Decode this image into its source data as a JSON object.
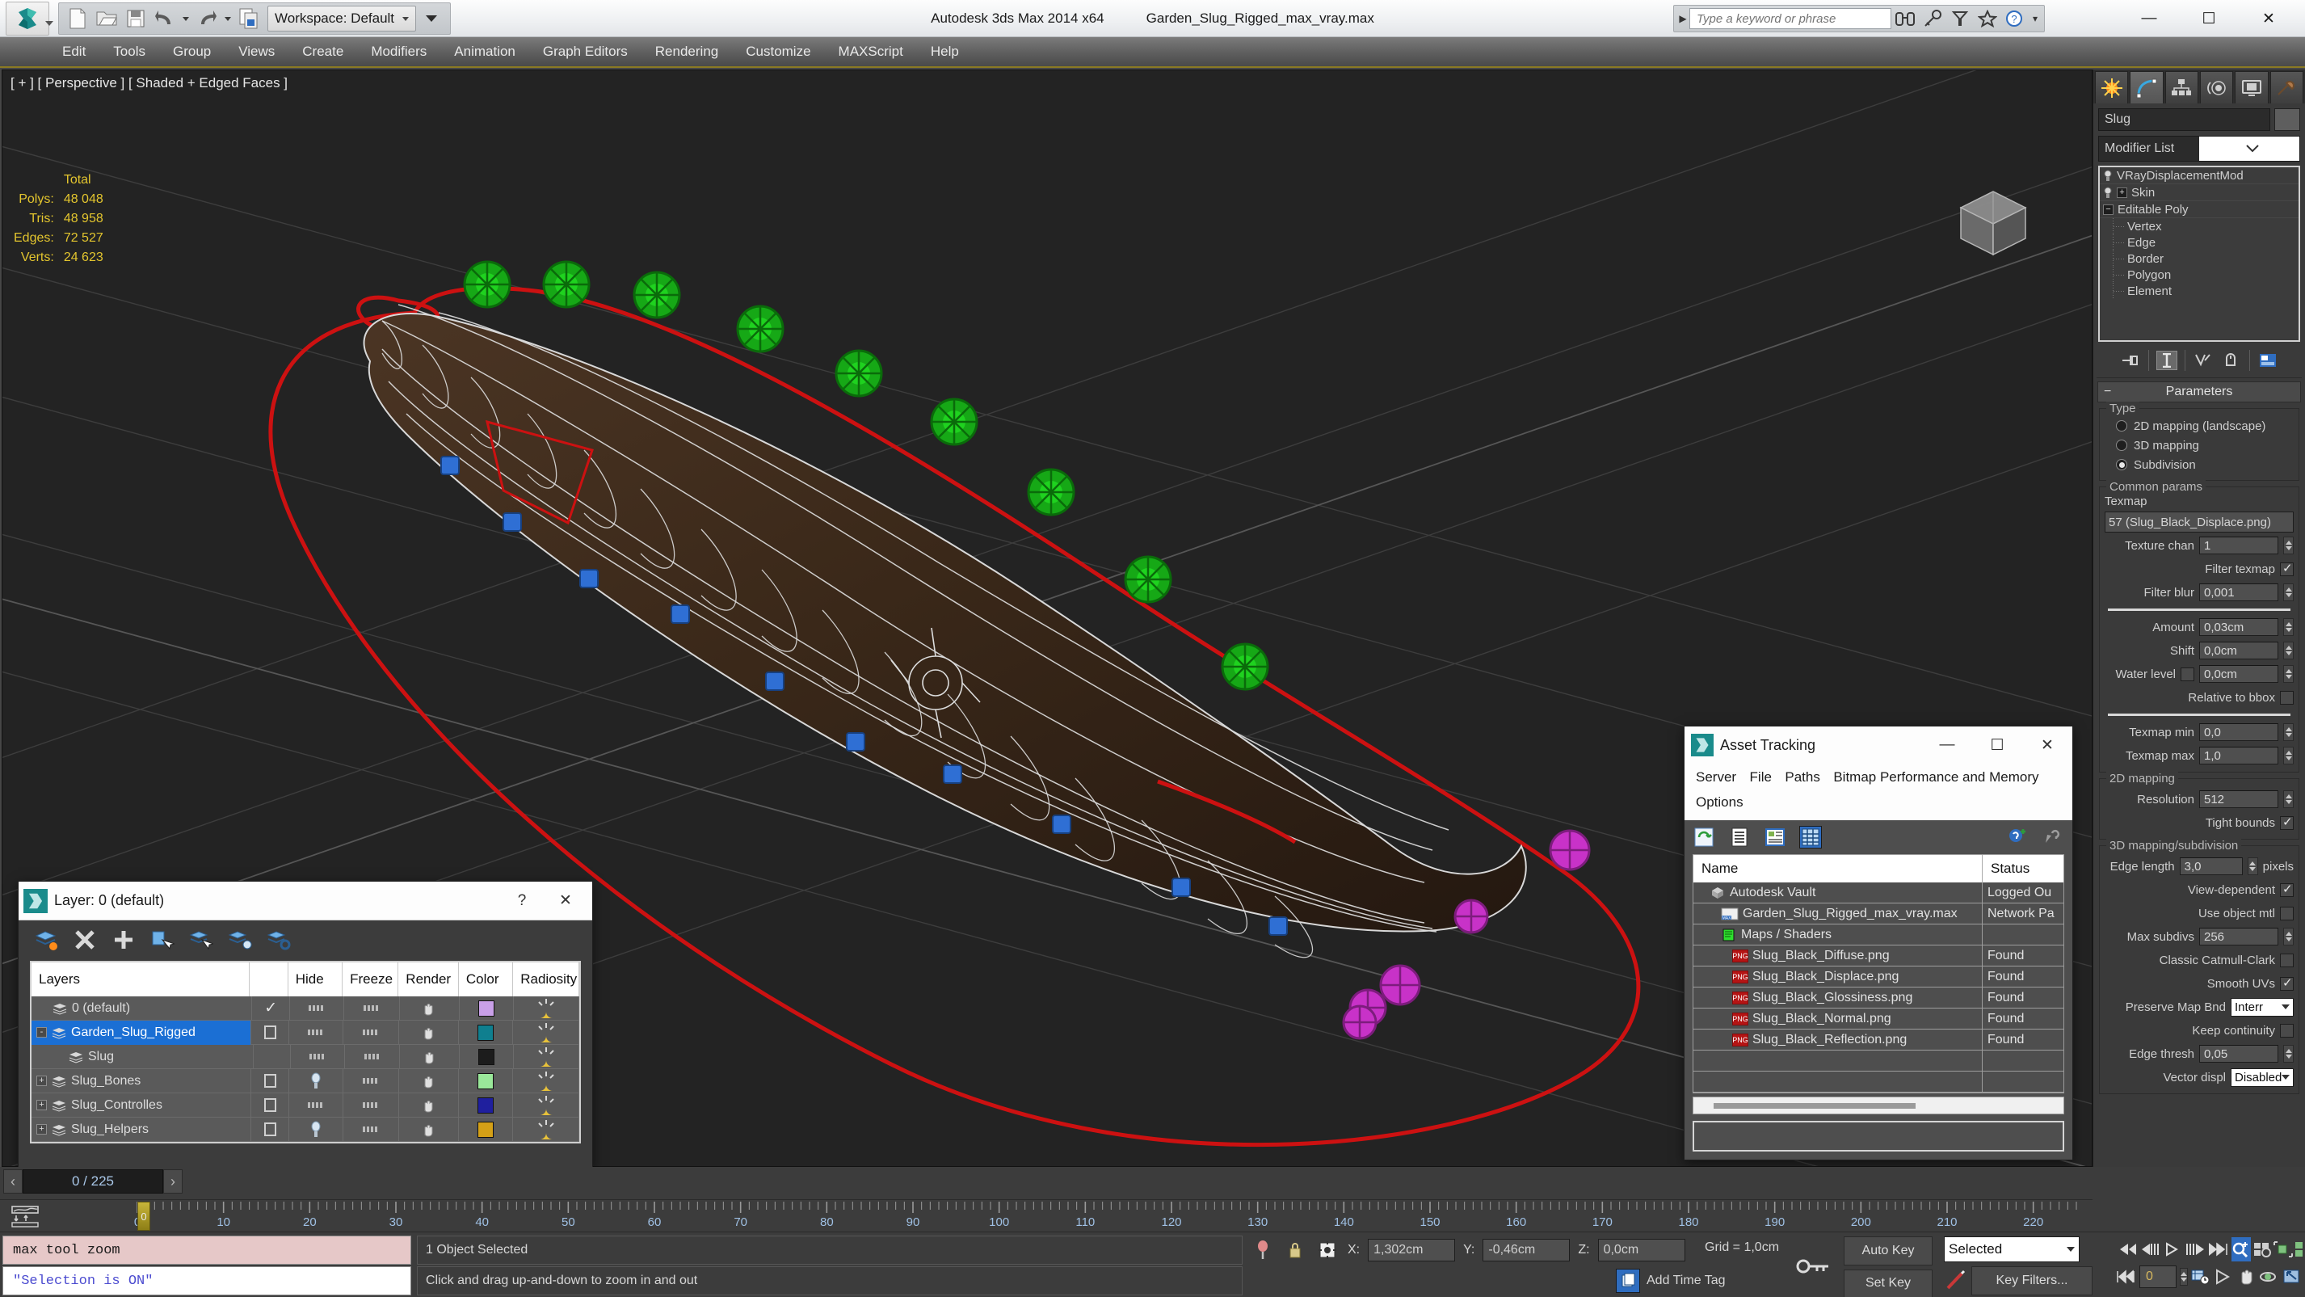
{
  "window": {
    "app_title": "Autodesk 3ds Max  2014 x64",
    "file_title": "Garden_Slug_Rigged_max_vray.max",
    "minimize": "—",
    "maximize": "☐",
    "close": "✕"
  },
  "quick_access": {
    "workspace_label": "Workspace: Default",
    "icons": [
      "new-icon",
      "open-icon",
      "save-icon",
      "undo-icon",
      "redo-icon",
      "project-icon"
    ]
  },
  "search": {
    "placeholder": "Type a keyword or phrase",
    "icons": [
      "binoculars-icon",
      "key-icon",
      "subscription-icon",
      "star-icon",
      "help-icon"
    ]
  },
  "menu": {
    "items": [
      "Edit",
      "Tools",
      "Group",
      "Views",
      "Create",
      "Modifiers",
      "Animation",
      "Graph Editors",
      "Rendering",
      "Customize",
      "MAXScript",
      "Help"
    ]
  },
  "viewport": {
    "label": "[ + ] [ Perspective ] [ Shaded + Edged Faces ]",
    "stats_header": "Total",
    "stats": [
      {
        "label": "Polys:",
        "value": "48 048"
      },
      {
        "label": "Tris:",
        "value": "48 958"
      },
      {
        "label": "Edges:",
        "value": "72 527"
      },
      {
        "label": "Verts:",
        "value": "24 623"
      }
    ]
  },
  "command_panel": {
    "tabs": [
      "create-tab",
      "modify-tab",
      "hierarchy-tab",
      "motion-tab",
      "display-tab",
      "utilities-tab"
    ],
    "active_tab_index": 1,
    "object_name": "Slug",
    "modifier_list_label": "Modifier List",
    "stack": [
      {
        "name": "VRayDisplacementMod",
        "has_expand": false,
        "indent": 1
      },
      {
        "name": "Skin",
        "has_expand": true,
        "indent": 1
      },
      {
        "name": "Editable Poly",
        "has_expand": true,
        "expanded": true,
        "indent": 0
      },
      {
        "name": "Vertex",
        "sub": true
      },
      {
        "name": "Edge",
        "sub": true
      },
      {
        "name": "Border",
        "sub": true
      },
      {
        "name": "Polygon",
        "sub": true
      },
      {
        "name": "Element",
        "sub": true
      }
    ],
    "stack_tools": [
      "pin-stack-icon",
      "show-end-result-icon",
      "make-unique-icon",
      "remove-modifier-icon",
      "configure-sets-icon"
    ],
    "rollout": {
      "title": "Parameters",
      "type_group_label": "Type",
      "type_options": [
        {
          "label": "2D mapping (landscape)",
          "selected": false
        },
        {
          "label": "3D mapping",
          "selected": false
        },
        {
          "label": "Subdivision",
          "selected": true
        }
      ],
      "common_group_label": "Common params",
      "texmap_label": "Texmap",
      "texmap_value": "57 (Slug_Black_Displace.png)",
      "fields": [
        {
          "label": "Texture chan",
          "value": "1",
          "type": "spinner"
        },
        {
          "label": "Filter texmap",
          "value": "",
          "type": "checkbox",
          "checked": true
        },
        {
          "label": "Filter blur",
          "value": "0,001",
          "type": "spinner"
        },
        {
          "label": "Amount",
          "value": "0,03cm",
          "type": "spinner"
        },
        {
          "label": "Shift",
          "value": "0,0cm",
          "type": "spinner"
        },
        {
          "label": "Water level",
          "value": "0,0cm",
          "type": "spinner-check",
          "checked": false
        },
        {
          "label": "Relative to bbox",
          "value": "",
          "type": "checkbox",
          "checked": false
        },
        {
          "label": "Texmap min",
          "value": "0,0",
          "type": "spinner"
        },
        {
          "label": "Texmap max",
          "value": "1,0",
          "type": "spinner"
        }
      ],
      "mapping2d_group_label": "2D mapping",
      "mapping2d_fields": [
        {
          "label": "Resolution",
          "value": "512",
          "type": "spinner"
        },
        {
          "label": "Tight bounds",
          "value": "",
          "type": "checkbox",
          "checked": true
        }
      ],
      "mapping3d_group_label": "3D mapping/subdivision",
      "mapping3d_fields": [
        {
          "label": "Edge length",
          "value": "3,0",
          "type": "spinner",
          "suffix": "pixels"
        },
        {
          "label": "View-dependent",
          "value": "",
          "type": "checkbox",
          "checked": true
        },
        {
          "label": "Use object mtl",
          "value": "",
          "type": "checkbox",
          "checked": false
        },
        {
          "label": "Max subdivs",
          "value": "256",
          "type": "spinner"
        },
        {
          "label": "Classic Catmull-Clark",
          "value": "",
          "type": "checkbox",
          "checked": false
        },
        {
          "label": "Smooth UVs",
          "value": "",
          "type": "checkbox",
          "checked": true
        },
        {
          "label": "Preserve Map Bnd",
          "value": "Interr",
          "type": "combo"
        },
        {
          "label": "Keep continuity",
          "value": "",
          "type": "checkbox",
          "checked": false
        },
        {
          "label": "Edge thresh",
          "value": "0,05",
          "type": "spinner"
        },
        {
          "label": "Vector displ",
          "value": "Disabled",
          "type": "combo"
        }
      ]
    }
  },
  "layer_dialog": {
    "title": "Layer: 0 (default)",
    "help_btn": "?",
    "close_btn": "✕",
    "toolbar_icons": [
      "create-new-layer-icon",
      "delete-layer-icon",
      "add-selection-icon",
      "select-objects-in-layer-icon",
      "select-highlighted-objects-icon",
      "highlight-selected-objects-icon",
      "layer-properties-icon"
    ],
    "columns": [
      "Layers",
      "",
      "Hide",
      "Freeze",
      "Render",
      "Color",
      "Radiosity"
    ],
    "rows": [
      {
        "name": "0 (default)",
        "indent": 1,
        "current": true,
        "expand": "",
        "hide": "dash",
        "freeze": "dash",
        "render": "on",
        "color": "#c9a0e8",
        "selected": false
      },
      {
        "name": "Garden_Slug_Rigged",
        "indent": 0,
        "current": false,
        "expand": "-",
        "hide": "dash",
        "freeze": "dash",
        "render": "on",
        "color": "#0f7f8f",
        "selected": true
      },
      {
        "name": "Slug",
        "indent": 2,
        "current": false,
        "expand": "",
        "hide": "dash",
        "freeze": "dash",
        "render": "on",
        "color": "#1c1c1c",
        "selected": false
      },
      {
        "name": "Slug_Bones",
        "indent": 0,
        "current": false,
        "expand": "+",
        "hide": "bulb",
        "freeze": "dash",
        "render": "on",
        "color": "#9ae89a",
        "selected": false
      },
      {
        "name": "Slug_Controlles",
        "indent": 0,
        "current": false,
        "expand": "+",
        "hide": "dash",
        "freeze": "dash",
        "render": "on",
        "color": "#1f1f9e",
        "selected": false
      },
      {
        "name": "Slug_Helpers",
        "indent": 0,
        "current": false,
        "expand": "+",
        "hide": "bulb",
        "freeze": "dash",
        "render": "on",
        "color": "#d4a017",
        "selected": false
      }
    ]
  },
  "asset_dialog": {
    "title": "Asset Tracking",
    "minimize": "—",
    "maximize": "☐",
    "close": "✕",
    "menu": [
      "Server",
      "File",
      "Paths",
      "Bitmap Performance and Memory",
      "Options"
    ],
    "toolbar_icons": [
      "refresh-icon",
      "list-view-icon",
      "detail-view-icon",
      "grid-view-icon",
      "help-new-icon",
      "help-icon"
    ],
    "columns": [
      "Name",
      "Status"
    ],
    "rows": [
      {
        "name": "Autodesk Vault",
        "status": "Logged Ou",
        "icon": "vault-icon",
        "indent": 1
      },
      {
        "name": "Garden_Slug_Rigged_max_vray.max",
        "status": "Network Pa",
        "icon": "max-file-icon",
        "indent": 2
      },
      {
        "name": "Maps / Shaders",
        "status": "",
        "icon": "maps-icon",
        "indent": 2
      },
      {
        "name": "Slug_Black_Diffuse.png",
        "status": "Found",
        "icon": "png-icon",
        "indent": 3
      },
      {
        "name": "Slug_Black_Displace.png",
        "status": "Found",
        "icon": "png-icon",
        "indent": 3
      },
      {
        "name": "Slug_Black_Glossiness.png",
        "status": "Found",
        "icon": "png-icon",
        "indent": 3
      },
      {
        "name": "Slug_Black_Normal.png",
        "status": "Found",
        "icon": "png-icon",
        "indent": 3
      },
      {
        "name": "Slug_Black_Reflection.png",
        "status": "Found",
        "icon": "png-icon",
        "indent": 3
      }
    ]
  },
  "timeline": {
    "frame_display": "0 / 225",
    "prev_arrow": "‹",
    "next_arrow": "›",
    "current_frame": 0,
    "ticks": [
      0,
      10,
      20,
      30,
      40,
      50,
      60,
      70,
      80,
      90,
      100,
      110,
      120,
      130,
      140,
      150,
      160,
      170,
      180,
      190,
      200,
      210,
      220
    ],
    "max_frame": 225
  },
  "status_bar": {
    "max_prompt": "max tool zoom",
    "max_listener": "\"Selection is ON\"",
    "selection_status": "1 Object Selected",
    "hint": "Click and drag up-and-down to zoom in and out",
    "coords": [
      {
        "axis": "X:",
        "value": "1,302cm"
      },
      {
        "axis": "Y:",
        "value": "-0,46cm"
      },
      {
        "axis": "Z:",
        "value": "0,0cm"
      }
    ],
    "grid": "Grid = 1,0cm",
    "add_time_tag": "Add Time Tag",
    "auto_key": "Auto Key",
    "set_key": "Set Key",
    "key_filters": "Key Filters...",
    "key_mode": "Selected",
    "frame_field": "0"
  },
  "colors": {
    "accent_blue": "#1b6fd4",
    "panel_bg": "#3a3a3a",
    "viewport_bg": "#232323",
    "stats_yellow": "#e3c52e",
    "menu_underline": "#8a7a23",
    "spline_red": "#cc1111",
    "bone_green": "#1db01d",
    "ctrl_blue": "#2a6fd0",
    "helper_magenta": "#c832c8"
  }
}
